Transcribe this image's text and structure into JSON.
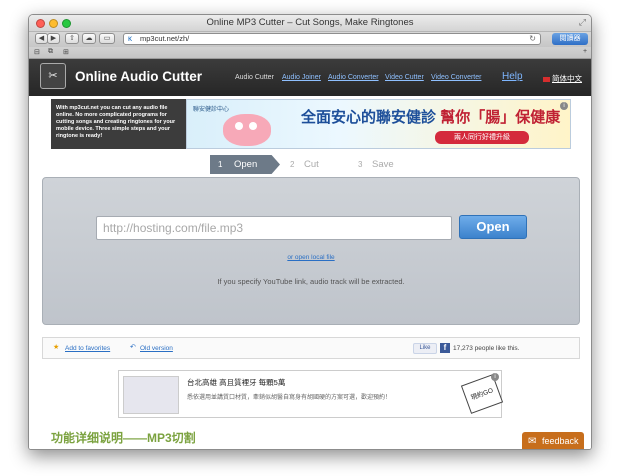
{
  "window": {
    "title": "Online MP3 Cutter – Cut Songs, Make Ringtones",
    "url": "mp3cut.net/zh/",
    "reader_label": "閱讀器",
    "colors": {
      "close": "#ff5f57",
      "minimize": "#febc2e",
      "zoom": "#28c840"
    }
  },
  "header": {
    "app_name": "Online Audio Cutter",
    "nav": [
      "Audio Cutter",
      "Audio Joiner",
      "Audio Converter",
      "Video Cutter",
      "Video Converter"
    ],
    "help": "Help",
    "language": "简体中文"
  },
  "promo": {
    "text": "With mp3cut.net you can cut any audio file online. No more complicated programs for cutting songs and creating ringtones for your mobile device. Three simple steps and your ringtone is ready!"
  },
  "ad_top": {
    "logo": "聯安健診中心",
    "headline_a": "全面安心的聯安健診",
    "headline_b": "幫你「腸」保健康",
    "sub": "兩人同行好禮升級"
  },
  "steps": [
    {
      "num": "1",
      "label": "Open"
    },
    {
      "num": "2",
      "label": "Cut"
    },
    {
      "num": "3",
      "label": "Save"
    }
  ],
  "main": {
    "url_placeholder": "http://hosting.com/file.mp3",
    "open_button": "Open",
    "local_link": "or open local file",
    "hint": "If you specify YouTube link, audio track will be extracted."
  },
  "shares": {
    "favorites": "Add to favorites",
    "old_version": "Old version",
    "like": "Like",
    "like_count": "17,273 people like this."
  },
  "ad_bottom": {
    "title": "台北高雄 高且質裡牙 每顆5萬",
    "sub": "悉依選用並講質口材質，牽銷似胡醫自寫身有胡國硬的方案可選，歡迎預約！",
    "tag": "現約GO"
  },
  "footer": {
    "title": "功能详细说明——MP3切割",
    "feedback": "feedback"
  }
}
